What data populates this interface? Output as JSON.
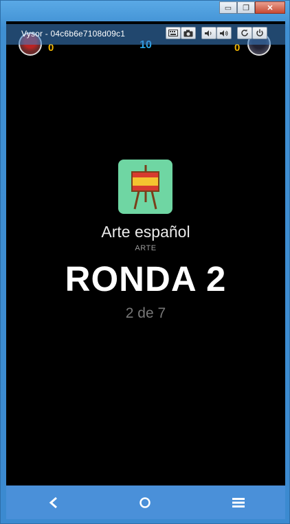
{
  "window": {
    "title": "Vysor - 04c6b6e7108d09c1",
    "minimize_label": "▭",
    "restore_label": "❐",
    "close_label": "✕"
  },
  "toolbar": {
    "keyboard_icon": "keyboard-icon",
    "camera_icon": "camera-icon",
    "volume_down_icon": "volume-down-icon",
    "volume_up_icon": "volume-up-icon",
    "rotate_icon": "rotate-icon",
    "power_icon": "power-icon"
  },
  "game": {
    "player_left_score": "0",
    "player_right_score": "0",
    "center_score": "10",
    "category_title": "Arte español",
    "category_subtitle": "ARTE",
    "round_label": "RONDA 2",
    "round_progress": "2 de 7"
  },
  "navbar": {
    "back_icon": "back-icon",
    "home_icon": "home-icon",
    "menu_icon": "menu-icon"
  },
  "colors": {
    "score": "#f0b400",
    "center_score": "#2aa7e8",
    "category_bg": "#6fd6a3",
    "navbar": "#4a90d9"
  }
}
